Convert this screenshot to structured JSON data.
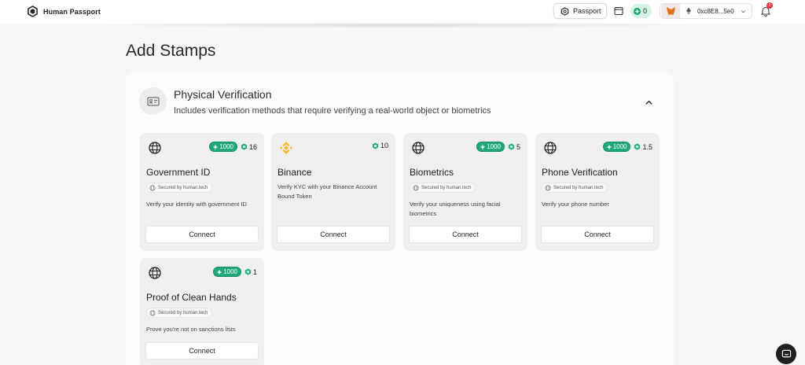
{
  "header": {
    "brand_name": "Human Passport",
    "passport_label": "Passport",
    "score": "0",
    "wallet_address": "0xc8E8...5e0",
    "notification_count": "2"
  },
  "page": {
    "title": "Add Stamps"
  },
  "section": {
    "title": "Physical Verification",
    "description": "Includes verification methods that require verifying a real-world object or biometrics"
  },
  "cards": [
    {
      "title": "Government ID",
      "badge": "1000",
      "points": "16",
      "secured": "Secured by human.tech",
      "description": "Verify your identity with government ID",
      "connect": "Connect"
    },
    {
      "title": "Binance",
      "points": "10",
      "description": "Verify KYC with your Binance Account Bound Token",
      "connect": "Connect"
    },
    {
      "title": "Biometrics",
      "badge": "1000",
      "points": "5",
      "secured": "Secured by human.tech",
      "description": "Verify your uniqueness using facial biometrics",
      "connect": "Connect"
    },
    {
      "title": "Phone Verification",
      "badge": "1000",
      "points": "1.5",
      "secured": "Secured by human.tech",
      "description": "Verify your phone number",
      "connect": "Connect"
    },
    {
      "title": "Proof of Clean Hands",
      "badge": "1000",
      "points": "1",
      "secured": "Secured by human.tech",
      "description": "Prove you're not on sanctions lists",
      "connect": "Connect"
    }
  ],
  "icons": {
    "brand": "human-passport-logo",
    "passport": "passport-icon",
    "window": "window-icon",
    "score": "score-icon",
    "wallet": "metamask-fox-icon",
    "network": "ethereum-icon",
    "notifications": "bell-icon",
    "section": "id-card-icon",
    "card_provider": "human-tech-globe-icon",
    "binance": "binance-icon",
    "chat": "chat-icon"
  },
  "colors": {
    "accent": "#1fa879",
    "binance": "#f3ba2f",
    "badge": "#e5363a"
  }
}
